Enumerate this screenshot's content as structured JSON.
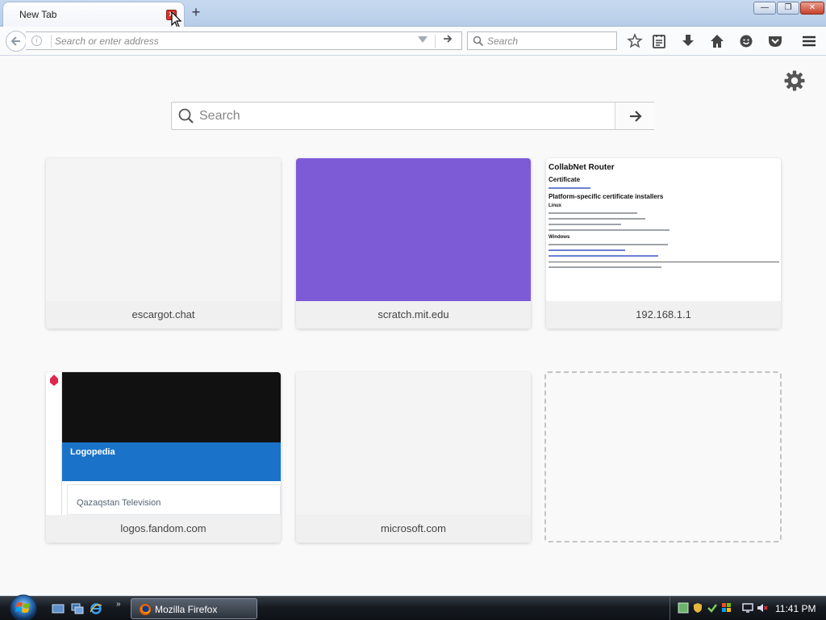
{
  "tabs": [
    {
      "title": "New Tab",
      "active": true
    }
  ],
  "window_controls": {
    "minimize": "—",
    "maximize": "❐",
    "close": "✕"
  },
  "toolbar": {
    "address_placeholder": "Search or enter address",
    "search_placeholder": "Search",
    "icons": [
      "back-icon",
      "info-icon",
      "dropdown-icon",
      "go-icon",
      "search-icon",
      "bookmark-star-icon",
      "reading-list-icon",
      "download-icon",
      "home-icon",
      "hello-icon",
      "pocket-icon",
      "menu-icon"
    ]
  },
  "newtab": {
    "search_placeholder": "Search",
    "tiles": [
      {
        "label": "escargot.chat"
      },
      {
        "label": "scratch.mit.edu",
        "color": "#7e5bd6"
      },
      {
        "label": "192.168.1.1"
      },
      {
        "label": "logos.fandom.com"
      },
      {
        "label": "microsoft.com"
      }
    ],
    "tile_thumbs": {
      "router": {
        "title": "CollabNet Router",
        "section1": "Certificate",
        "section2": "Platform-specific certificate installers",
        "sub1": "Linux",
        "sub2": "Windows"
      },
      "fandom": {
        "logo": "Logopedia",
        "heading": "Qazaqstan Television"
      }
    }
  },
  "taskbar": {
    "window_button": "Mozilla Firefox",
    "clock": "11:41 PM",
    "quicklaunch": [
      "show-desktop-icon",
      "switch-windows-icon",
      "internet-explorer-icon"
    ]
  },
  "colors": {
    "accent_purple": "#7e5bd6",
    "page_bg": "#f9f9fa",
    "taskbar": "#161b21"
  }
}
